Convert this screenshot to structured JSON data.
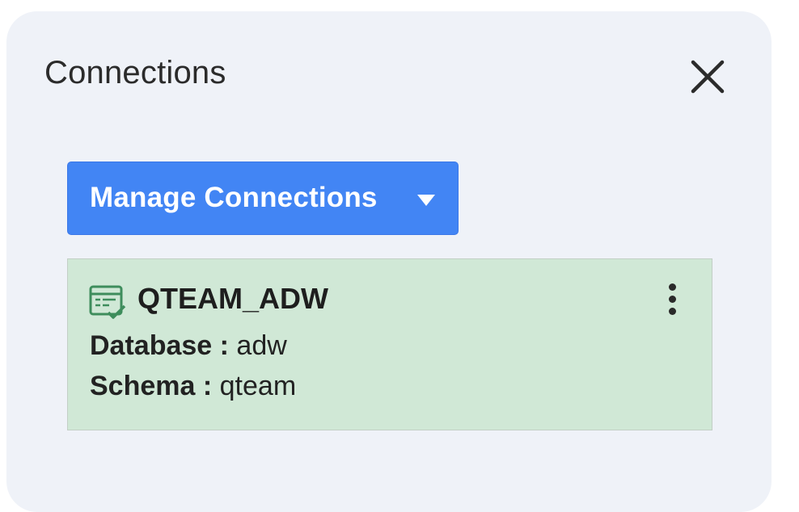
{
  "panel": {
    "title": "Connections",
    "close_icon": "close-icon"
  },
  "manage_button": {
    "label": "Manage Connections",
    "icon": "caret-down-icon",
    "color": "#4285f4"
  },
  "connection": {
    "name": "QTEAM_ADW",
    "icon": "database-connected-icon",
    "menu_icon": "kebab-menu-icon",
    "background": "#d0e8d6",
    "database_label": "Database :",
    "database_value": "adw",
    "schema_label": "Schema :",
    "schema_value": "qteam"
  }
}
